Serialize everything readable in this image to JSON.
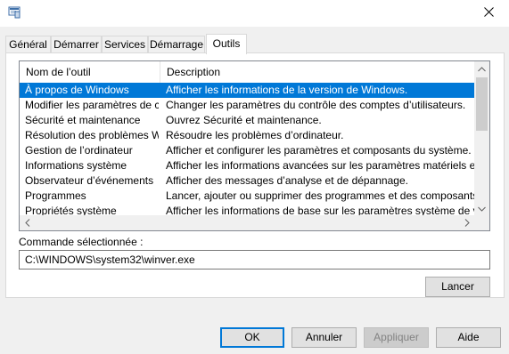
{
  "window": {
    "title": ""
  },
  "tabs": [
    {
      "label": "Général"
    },
    {
      "label": "Démarrer"
    },
    {
      "label": "Services"
    },
    {
      "label": "Démarrage"
    },
    {
      "label": "Outils"
    }
  ],
  "active_tab": "Outils",
  "list": {
    "columns": [
      "Nom de l’outil",
      "Description"
    ],
    "rows": [
      {
        "name": "À propos de Windows",
        "description": "Afficher les informations de la version de Windows.",
        "selected": true
      },
      {
        "name": "Modifier les paramètres de c...",
        "description": "Changer les paramètres du contrôle des comptes d’utilisateurs."
      },
      {
        "name": "Sécurité et maintenance",
        "description": "Ouvrez Sécurité et maintenance."
      },
      {
        "name": "Résolution des problèmes Wi...",
        "description": "Résoudre les problèmes d’ordinateur."
      },
      {
        "name": "Gestion de l’ordinateur",
        "description": "Afficher et configurer les paramètres et composants du système."
      },
      {
        "name": "Informations système",
        "description": "Afficher les informations avancées sur les paramètres matériels et logiciels."
      },
      {
        "name": "Observateur d’événements",
        "description": "Afficher des messages d’analyse et de dépannage."
      },
      {
        "name": "Programmes",
        "description": "Lancer, ajouter ou supprimer des programmes et des composants Windows."
      },
      {
        "name": "Propriétés système",
        "description": "Afficher les informations de base sur les paramètres système de votre ordinateur."
      }
    ]
  },
  "command": {
    "label": "Commande sélectionnée :",
    "value": "C:\\WINDOWS\\system32\\winver.exe"
  },
  "buttons": {
    "launch": "Lancer",
    "ok": "OK",
    "cancel": "Annuler",
    "apply": "Appliquer",
    "help": "Aide"
  },
  "colors": {
    "selection": "#0078d7",
    "default_button_border": "#0078d7"
  },
  "icons": {
    "app": "msconfig-icon",
    "close": "close-icon",
    "scroll_up": "chevron-up-icon",
    "scroll_down": "chevron-down-icon",
    "scroll_left": "chevron-left-icon",
    "scroll_right": "chevron-right-icon"
  }
}
